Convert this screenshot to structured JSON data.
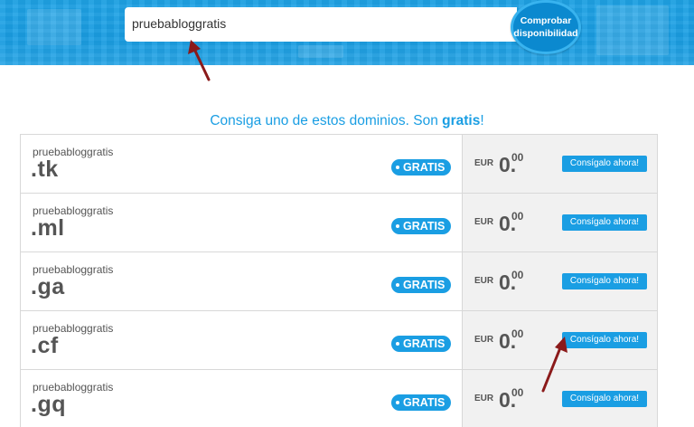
{
  "search": {
    "value": "pruebabloggratis"
  },
  "check_button": {
    "label_line1": "Comprobar",
    "label_line2": "disponibilidad"
  },
  "promo": {
    "text": "Consiga uno de estos dominios. Son ",
    "bold": "gratis",
    "end": "!"
  },
  "rows": [
    {
      "name": "pruebabloggratis",
      "tld": ".tk",
      "badge": "GRATIS",
      "currency": "EUR",
      "price_int": "0.",
      "price_dec": "00",
      "button": "Consígalo ahora!"
    },
    {
      "name": "pruebabloggratis",
      "tld": ".ml",
      "badge": "GRATIS",
      "currency": "EUR",
      "price_int": "0.",
      "price_dec": "00",
      "button": "Consígalo ahora!"
    },
    {
      "name": "pruebabloggratis",
      "tld": ".ga",
      "badge": "GRATIS",
      "currency": "EUR",
      "price_int": "0.",
      "price_dec": "00",
      "button": "Consígalo ahora!"
    },
    {
      "name": "pruebabloggratis",
      "tld": ".cf",
      "badge": "GRATIS",
      "currency": "EUR",
      "price_int": "0.",
      "price_dec": "00",
      "button": "Consígalo ahora!"
    },
    {
      "name": "pruebabloggratis",
      "tld": ".gq",
      "badge": "GRATIS",
      "currency": "EUR",
      "price_int": "0.",
      "price_dec": "00",
      "button": "Consígalo ahora!"
    }
  ],
  "colors": {
    "accent": "#1a9ee3",
    "arrow": "#8b1a1a",
    "price_bg": "#f1f1f1"
  }
}
